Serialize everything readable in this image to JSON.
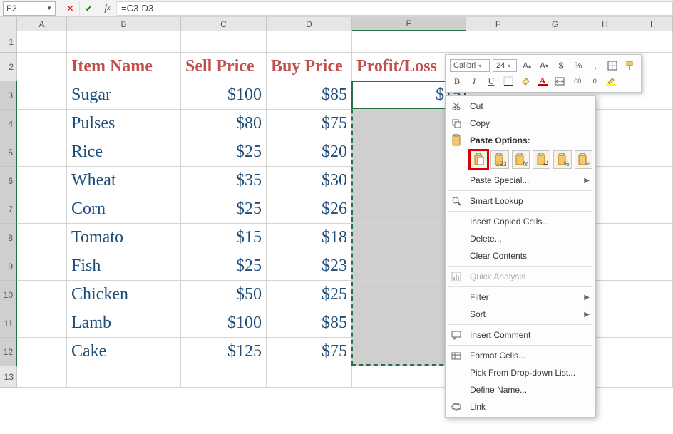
{
  "formula_bar": {
    "name_box": "E3",
    "formula": "=C3-D3"
  },
  "columns": [
    "A",
    "B",
    "C",
    "D",
    "E",
    "F",
    "G",
    "H",
    "I"
  ],
  "selected_col": "E",
  "row_count": 13,
  "selected_rows_start": 3,
  "selected_rows_end": 12,
  "headers": {
    "B": "Item Name",
    "C": "Sell Price",
    "D": "Buy Price",
    "E": "Profit/Loss"
  },
  "profit_loss_value": "$15",
  "chart_data": {
    "type": "table",
    "columns": [
      "Item Name",
      "Sell Price",
      "Buy Price"
    ],
    "rows": [
      {
        "item": "Sugar",
        "sell": "$100",
        "buy": "$85"
      },
      {
        "item": "Pulses",
        "sell": "$80",
        "buy": "$75"
      },
      {
        "item": "Rice",
        "sell": "$25",
        "buy": "$20"
      },
      {
        "item": "Wheat",
        "sell": "$35",
        "buy": "$30"
      },
      {
        "item": "Corn",
        "sell": "$25",
        "buy": "$26"
      },
      {
        "item": "Tomato",
        "sell": "$15",
        "buy": "$18"
      },
      {
        "item": "Fish",
        "sell": "$25",
        "buy": "$23"
      },
      {
        "item": "Chicken",
        "sell": "$50",
        "buy": "$25"
      },
      {
        "item": "Lamb",
        "sell": "$100",
        "buy": "$85"
      },
      {
        "item": "Cake",
        "sell": "$125",
        "buy": "$75"
      }
    ]
  },
  "mini_toolbar": {
    "font": "Calibri",
    "size": "24",
    "buttons_row1": [
      "increase-font",
      "decrease-font",
      "accounting-format",
      "percent-format",
      "comma-format",
      "borders",
      "format-painter"
    ],
    "bold": "B",
    "italic": "I",
    "underline": "U"
  },
  "context_menu": {
    "cut": "Cut",
    "copy": "Copy",
    "paste_options": "Paste Options:",
    "paste_special": "Paste Special...",
    "smart_lookup": "Smart Lookup",
    "insert_copied": "Insert Copied Cells...",
    "delete": "Delete...",
    "clear": "Clear Contents",
    "quick_analysis": "Quick Analysis",
    "filter": "Filter",
    "sort": "Sort",
    "insert_comment": "Insert Comment",
    "format_cells": "Format Cells...",
    "pick_list": "Pick From Drop-down List...",
    "define_name": "Define Name...",
    "link": "Link",
    "paste_icons": [
      "paste",
      "paste-values",
      "paste-formulas",
      "paste-transpose",
      "paste-formatting",
      "paste-link"
    ]
  }
}
